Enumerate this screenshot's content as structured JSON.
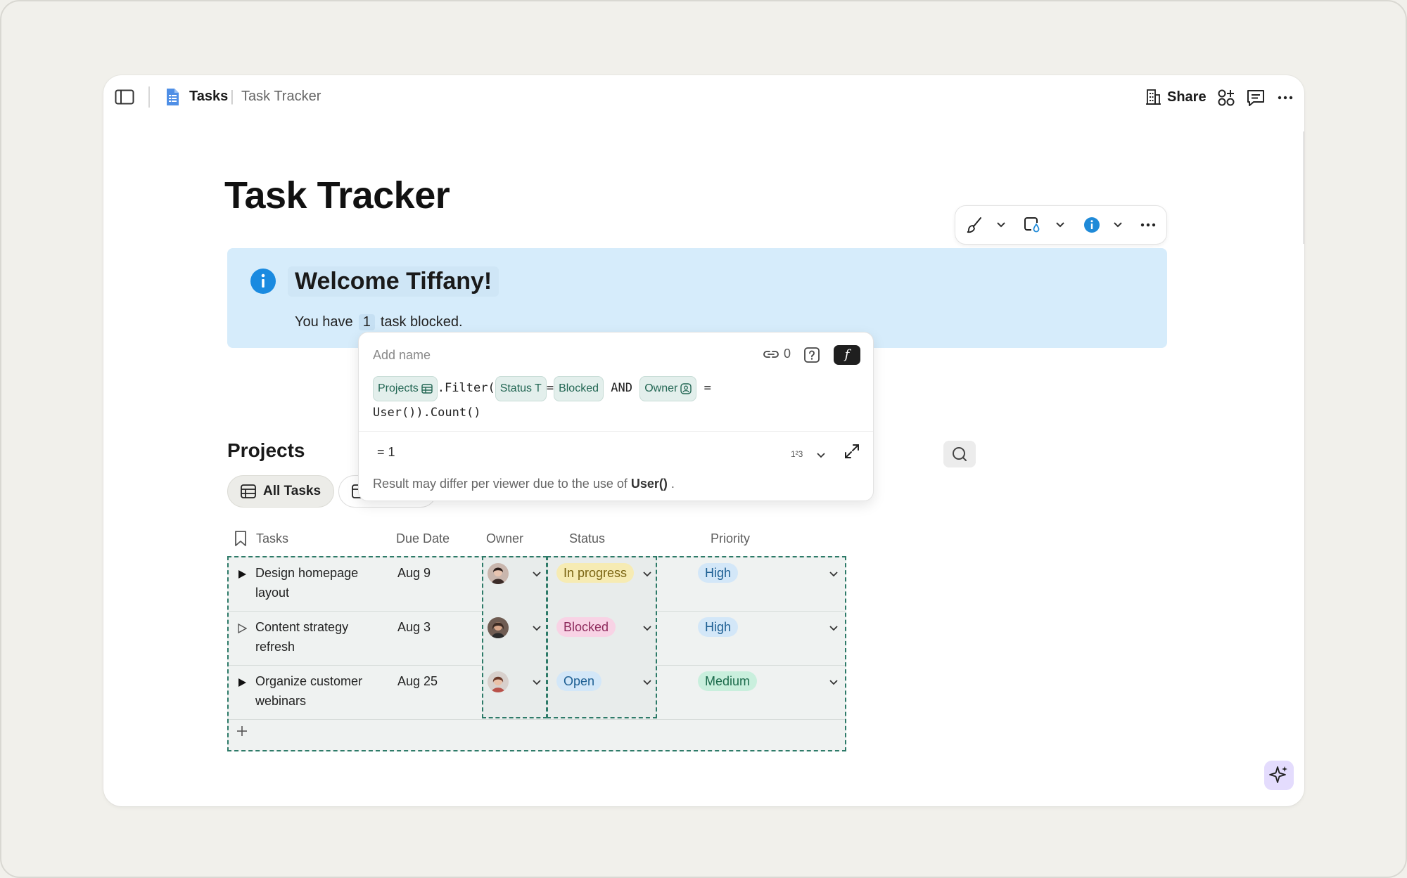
{
  "breadcrumb": {
    "doc": "Tasks",
    "page": "Task Tracker"
  },
  "header": {
    "share_label": "Share"
  },
  "page_title": "Task Tracker",
  "callout": {
    "heading": "Welcome Tiffany!",
    "line_before": "You have",
    "count": "1",
    "line_after": "task blocked."
  },
  "formula": {
    "name_placeholder": "Add name",
    "ref_count": "0",
    "fx_label": "f",
    "tokens": {
      "table": "Projects",
      "filter": ".Filter(",
      "status": "Status",
      "status_type": "T",
      "eq": "=",
      "blocked": "Blocked",
      "and": "AND",
      "owner": "Owner",
      "eq2": "=",
      "tail": "User()).Count()"
    },
    "result": "=  1",
    "format_label": "1²3",
    "note_before": "Result may differ per viewer due to the use of",
    "note_bold": "User()",
    "note_after": "."
  },
  "projects": {
    "title": "Projects",
    "views": [
      {
        "label": "All Tasks"
      },
      {
        "label": ""
      }
    ],
    "columns": [
      "Tasks",
      "Due Date",
      "Owner",
      "Status",
      "Priority"
    ],
    "rows": [
      {
        "task_l1": "Design homepage",
        "task_l2": "layout",
        "due": "Aug 9",
        "status": "In progress",
        "priority": "High",
        "expanded": true
      },
      {
        "task_l1": "Content strategy",
        "task_l2": "refresh",
        "due": "Aug 3",
        "status": "Blocked",
        "priority": "High",
        "expanded": false
      },
      {
        "task_l1": "Organize customer",
        "task_l2": "webinars",
        "due": "Aug 25",
        "status": "Open",
        "priority": "Medium",
        "expanded": true
      }
    ]
  },
  "colors": {
    "accent": "#2d7a68",
    "callout_bg": "#d6ecfb",
    "status_in_progress": "#f6ebb3",
    "status_blocked": "#f8d3e5",
    "status_open": "#d3e7f8",
    "priority_high": "#d3e7f8",
    "priority_medium": "#c9efdd"
  }
}
